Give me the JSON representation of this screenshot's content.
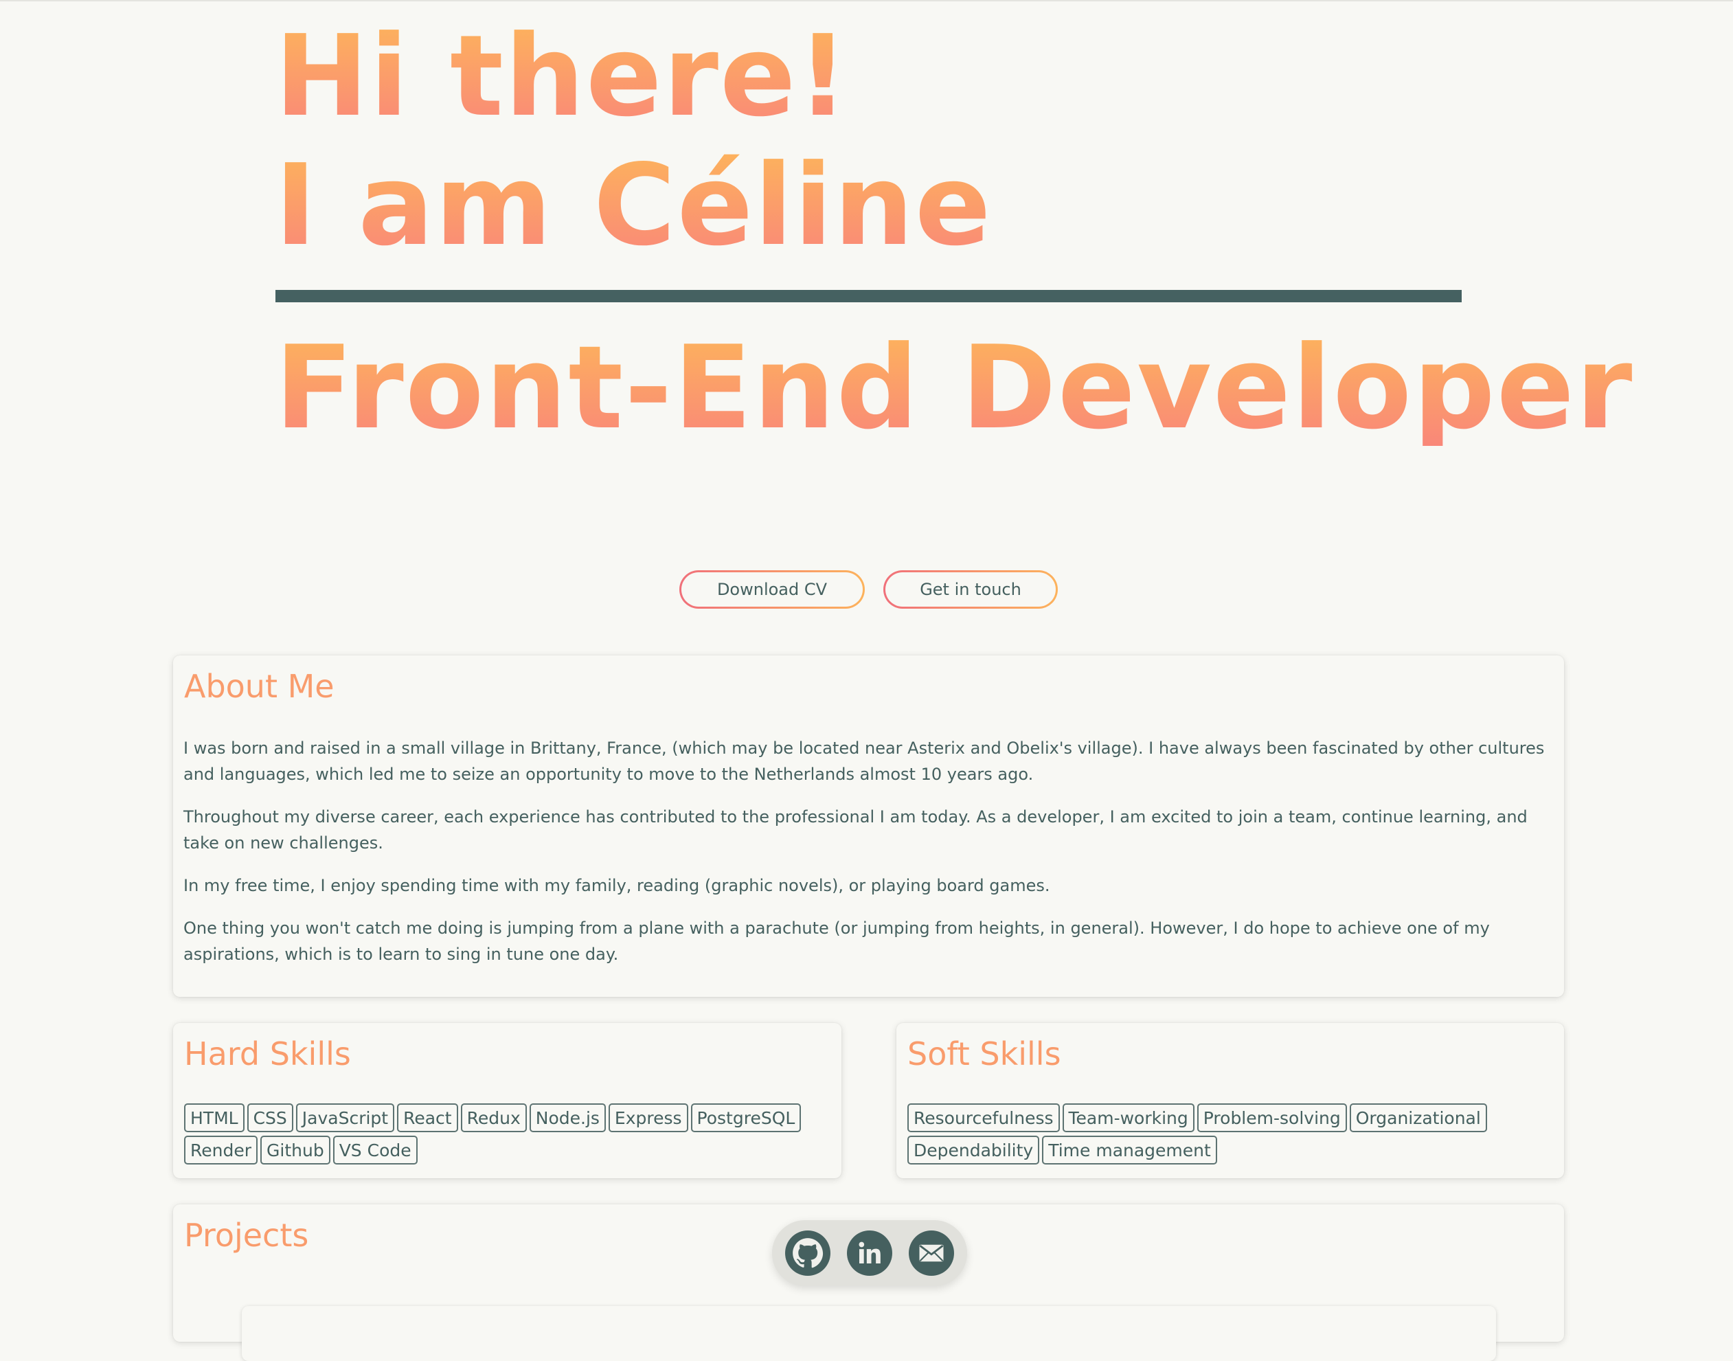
{
  "hero": {
    "greeting": "Hi there!",
    "name_line": "I am Céline",
    "role": "Front-End Developer"
  },
  "actions": {
    "download_cv": "Download CV",
    "get_in_touch": "Get in touch"
  },
  "about": {
    "title": "About Me",
    "paragraphs": [
      "I was born and raised in a small village in Brittany, France, (which may be located near Asterix and Obelix's village). I have always been fascinated by other cultures and languages, which led me to seize an opportunity to move to the Netherlands almost 10 years ago.",
      "Throughout my diverse career, each experience has contributed to the professional I am today. As a developer, I am excited to join a team, continue learning, and take on new challenges.",
      "In my free time, I enjoy spending time with my family, reading (graphic novels), or playing board games.",
      "One thing you won't catch me doing is jumping from a plane with a parachute (or jumping from heights, in general). However, I do hope to achieve one of my aspirations, which is to learn to sing in tune one day."
    ]
  },
  "hard_skills": {
    "title": "Hard Skills",
    "items": [
      "HTML",
      "CSS",
      "JavaScript",
      "React",
      "Redux",
      "Node.js",
      "Express",
      "PostgreSQL",
      "Render",
      "Github",
      "VS Code"
    ]
  },
  "soft_skills": {
    "title": "Soft Skills",
    "items": [
      "Resourcefulness",
      "Team-working",
      "Problem-solving",
      "Organizational",
      "Dependability",
      "Time management"
    ]
  },
  "projects": {
    "title": "Projects"
  },
  "social": {
    "icons": [
      "github-icon",
      "linkedin-icon",
      "mail-icon"
    ]
  },
  "colors": {
    "background": "#f8f8f4",
    "accent_gradient_start": "#fdb35c",
    "accent_gradient_end": "#f98779",
    "heading": "#f99c6c",
    "text": "#45605f",
    "divider": "#456161"
  }
}
